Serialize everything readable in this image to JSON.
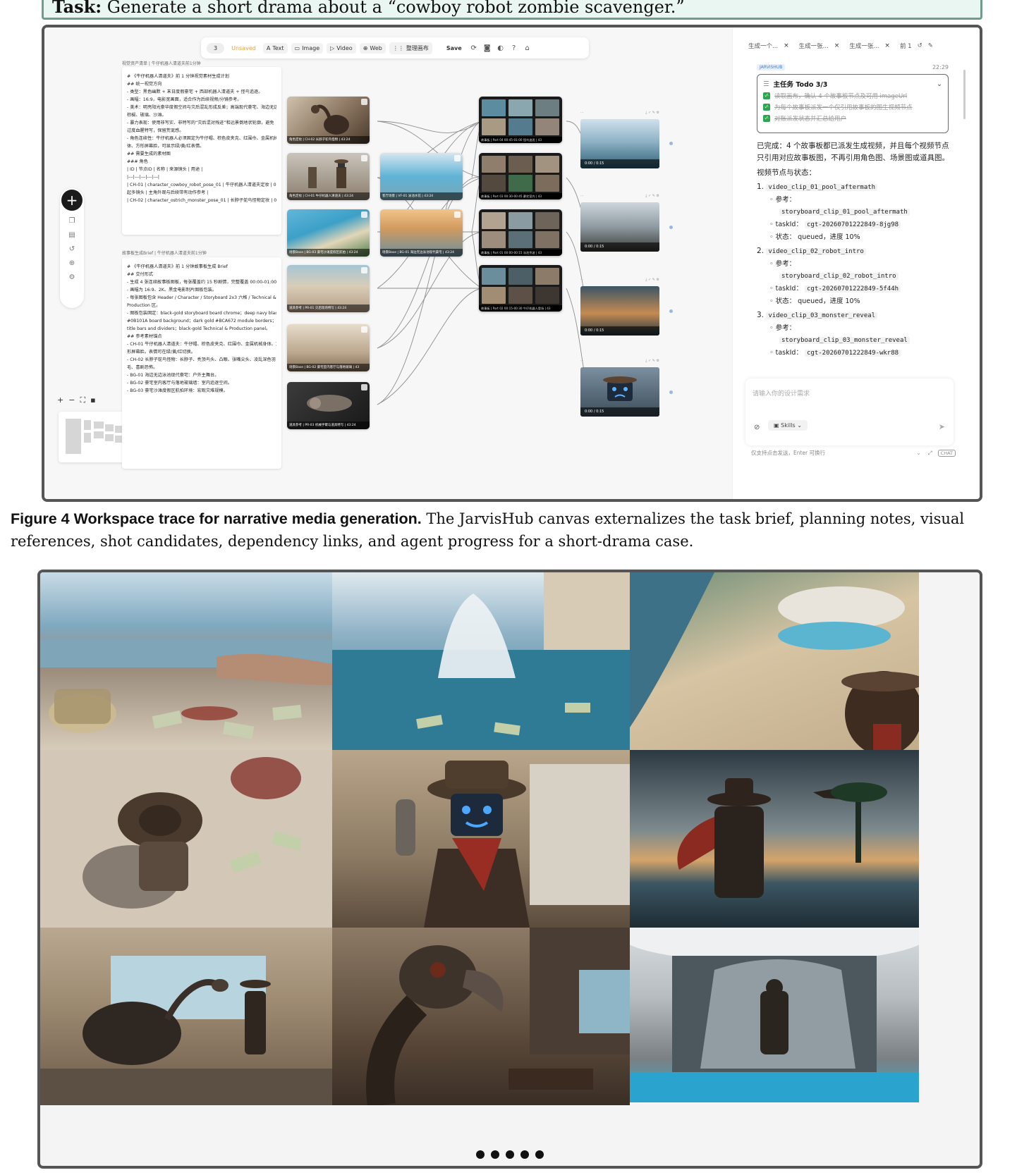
{
  "task": {
    "label": "Task:",
    "text": "Generate a short drama about a “cowboy robot zombie scavenger.”"
  },
  "toolbar": {
    "number": "3",
    "unsaved": "Unsaved",
    "text": "Text",
    "image": "Image",
    "video": "Video",
    "web": "Web",
    "arrange": "整理画布",
    "save": "Save"
  },
  "doc1": {
    "label": "视觉资产清单 | 牛仔机器人清道夫前1分钟",
    "lines": [
      "# 《牛仔机器人清道夫》前 1 分钟视觉素材生成计划",
      "## 统一视觉方向",
      "- 类型：黑色幽默 + 末日度假豪宅 + 西部机器人清道夫 + 怪鸟追逐。",
      "- 画幅：16:9，电影宽画面，适合作为后续视频/分镜参考。",
      "- 美术：明亮阳光豪华度假空间与灾后混乱形成反差；高端现代豪宅、海边无边泳池、",
      "  棕榈、玻璃、沙滩。",
      "- 暴力表现：使用非写实、非特写的“灾后混对残迹”和远景倒地状轮廓，避免",
      "  过度血腥特写，保留荒诞感。",
      "- 角色连续性：牛仔机器人必须固定为牛仔帽、棕色皮夹克、红围巾、金属机械身",
      "  体、方形屏幕脸，可显示绿/黄/红表情。",
      "## 需要生成的素材图",
      "### 角色",
      "| ID | 节点ID | 名称 | 来源镜头 | 用途 |",
      "|---|---|---|---|---|",
      "| CH-01 | character_cowboy_robot_pose_01 | 牛仔机器人清道夫定妆 | 00:14.5",
      "  起多镜头 | 主角外观与后续带有动作参考 |",
      "| CH-02 | character_ostrich_monster_pose_01 | 长脖子鸵鸟怪物定妆 | 00:33.5"
    ]
  },
  "doc2": {
    "label": "故事板生成Brief | 牛仔机器人清道夫前1分钟",
    "lines": [
      "# 《牛仔机器人清道夫》前 1 分钟故事板生成 Brief",
      "## 交付形式",
      "- 生成 4 张连续故事板图板，每张覆盖约 15 秒剧情，完整覆盖 00:00-01:00。",
      "- 画幅为 16:9、2K、黑金电影制片图板包装。",
      "- 每张图板包含 Header / Character / Storyboard 2x3 六格 / Technical &",
      "  Production 区。",
      "- 图板包装固定：black-gold storyboard board chrome；deep navy black",
      "  #0B101A board background；dark gold #BCA672 module borders；dark gold",
      "  title bars and dividers；black-gold Technical & Production panel。",
      "## 参考素材锚点",
      "- CH-01 牛仔机器人清道夫：牛仔帽、棕色皮夹克、红围巾、金属机械身体、方",
      "  形屏幕脸。表情可在绿/黄/红切换。",
      "- CH-02 长脖子鸵鸟怪物：长脖子、秃顶鸟头、凸眼、张嘴尖头、凌乱深色羽",
      "  毛、喜剧恐怖。",
      "- BG-01 海边无边泳池现代豪宅：户外主舞台。",
      "- BG-02 豪宅室内客厅与落地玻璃墙：室内追逐空间。",
      "- BG-03 豪宅沙滩度假区航拍环境：宏观灾难规模。"
    ]
  },
  "image_nodes": [
    {
      "caption": "角色定妆 | CH-02 长脖子鸵鸟怪物 | 43:24"
    },
    {
      "caption": "角色定妆 | CH-01 牛仔机器人清道夫 | 43:24"
    },
    {
      "caption": "场景Base | BG-03 豪宅沙滩度假区航拍 | 43:24"
    },
    {
      "caption": "道具参考 | PR-01 灾后现场特写 | 43:24"
    },
    {
      "caption": "场景Base | BG-02 豪宅室内客厅与落地玻璃 | 43"
    },
    {
      "caption": "道具参考 | PR-03 机械手臂与道具特写 | 43:24"
    },
    {
      "caption": "客厅场景 | VF-01 泳池水花 | 43:24"
    },
    {
      "caption": "场景Base | BG-01 海边无边泳池现代豪宅 | 43:24"
    }
  ],
  "storyboards": [
    {
      "caption": "故事板 | Part 04 00:45-01:00 怪鸟追逐 | 43"
    },
    {
      "caption": "故事板 | Part 03 00:30-00:45 豪宅室内 | 43"
    },
    {
      "caption": "故事板 | Part 01 00:00-00:15 泳池余波 | 43"
    },
    {
      "caption": "故事板 | Part 02 00:15-00:30 牛仔机器人登场 | 43"
    }
  ],
  "videos": [
    {
      "time": "0:00 / 0:15"
    },
    {
      "time": "0:00 / 0:15"
    },
    {
      "time": "0:00 / 0:15"
    },
    {
      "time": "0:00 / 0:15"
    }
  ],
  "chat": {
    "tabs": [
      "生成一个...",
      "生成一张...",
      "生成一张...",
      "前 1"
    ],
    "badge": "JARVISHUB",
    "time": "22:29",
    "todo_title": "主任务 Todo 3/3",
    "todos": [
      "读取画布，确认 4 个故事板节点及可用 imageUrl",
      "为每个故事板派发一个仅引用故事板的图生视频节点",
      "对账派发状态并汇总给用户"
    ],
    "summary": "已完成：4 个故事板都已派发生成视频，并且每个视频节点只引用对应故事板图，不再引用角色图、场景图或道具图。",
    "section": "视频节点与状态：",
    "ref_label": "参考：",
    "task_label": "taskId：",
    "status_label": "状态：",
    "clips": [
      {
        "num": "1.",
        "name": "video_clip_01_pool_aftermath",
        "ref": "storyboard_clip_01_pool_aftermath",
        "task": "cgt-20260701222849-8jg98",
        "status": "queued，进度 10%"
      },
      {
        "num": "2.",
        "name": "video_clip_02_robot_intro",
        "ref": "storyboard_clip_02_robot_intro",
        "task": "cgt-20260701222849-5f44h",
        "status": "queued，进度 10%"
      },
      {
        "num": "3.",
        "name": "video_clip_03_monster_reveal",
        "ref": "storyboard_clip_03_monster_reveal",
        "task": "cgt-20260701222849-wkr88"
      }
    ],
    "input_placeholder": "请输入你的设计需求",
    "skills": "Skills",
    "footer_hint": "仅支持点击发送，Enter 可换行",
    "mode": "CHAT"
  },
  "caption": {
    "lead": "Figure 4  Workspace trace for narrative media generation.",
    "body": " The JarvisHub canvas externalizes the task brief, planning notes, visual references, shot candidates, dependency links, and agent progress for a short-drama case."
  },
  "colors": {
    "accent_green": "#2ea44f",
    "frame": "#555555",
    "task_bg": "#eaf6f1"
  }
}
